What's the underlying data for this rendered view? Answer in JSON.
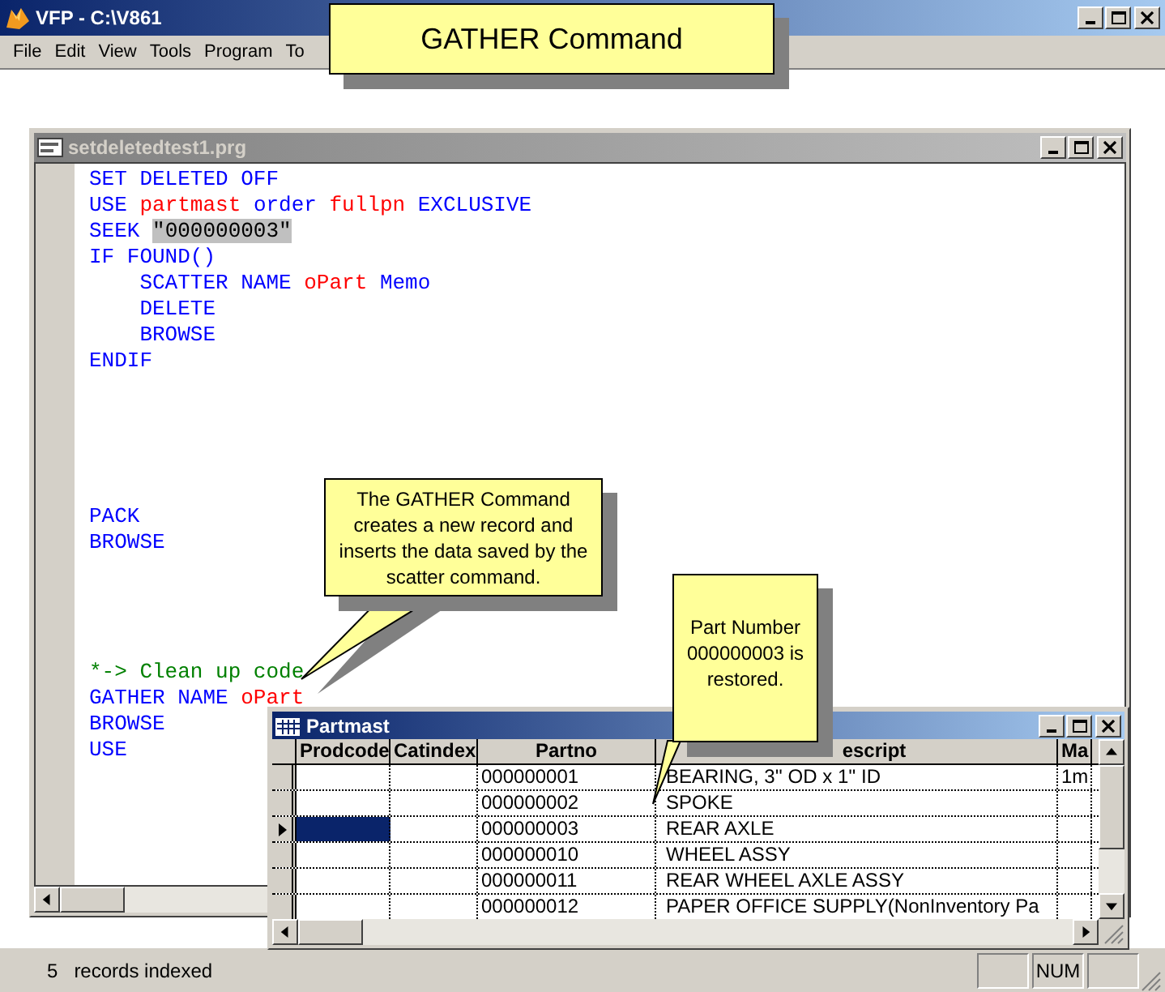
{
  "app_window": {
    "title": "VFP - C:\\V861"
  },
  "menu": [
    {
      "label": "File"
    },
    {
      "label": "Edit"
    },
    {
      "label": "View"
    },
    {
      "label": "Tools"
    },
    {
      "label": "Program"
    },
    {
      "label": "To"
    }
  ],
  "editor": {
    "title": "setdeletedtest1.prg",
    "lines": [
      {
        "kind": "code",
        "tokens": [
          {
            "text": "SET DELETED OFF",
            "kind": "keyword"
          }
        ]
      },
      {
        "kind": "code",
        "tokens": [
          {
            "text": "USE ",
            "kind": "keyword"
          },
          {
            "text": "partmast",
            "kind": "name"
          },
          {
            "text": " order ",
            "kind": "keyword"
          },
          {
            "text": "fullpn",
            "kind": "name"
          },
          {
            "text": " EXCLUSIVE",
            "kind": "keyword"
          }
        ]
      },
      {
        "kind": "code",
        "tokens": [
          {
            "text": "SEEK ",
            "kind": "keyword"
          },
          {
            "text": "\"000000003\"",
            "kind": "string",
            "highlighted": true
          }
        ]
      },
      {
        "kind": "code",
        "tokens": [
          {
            "text": "IF FOUND()",
            "kind": "keyword"
          }
        ]
      },
      {
        "kind": "code",
        "tokens": [
          {
            "text": "    SCATTER NAME ",
            "kind": "keyword"
          },
          {
            "text": "oPart",
            "kind": "name"
          },
          {
            "text": " Memo",
            "kind": "keyword"
          }
        ]
      },
      {
        "kind": "code",
        "tokens": [
          {
            "text": "    DELETE",
            "kind": "keyword"
          }
        ]
      },
      {
        "kind": "code",
        "tokens": [
          {
            "text": "    BROWSE",
            "kind": "keyword"
          }
        ]
      },
      {
        "kind": "code",
        "tokens": [
          {
            "text": "ENDIF",
            "kind": "keyword"
          }
        ]
      },
      {
        "kind": "blank"
      },
      {
        "kind": "blank"
      },
      {
        "kind": "blank"
      },
      {
        "kind": "blank"
      },
      {
        "kind": "blank"
      },
      {
        "kind": "code",
        "tokens": [
          {
            "text": "PACK",
            "kind": "keyword"
          }
        ]
      },
      {
        "kind": "code",
        "tokens": [
          {
            "text": "BROWSE",
            "kind": "keyword"
          }
        ]
      },
      {
        "kind": "blank"
      },
      {
        "kind": "blank"
      },
      {
        "kind": "blank"
      },
      {
        "kind": "blank"
      },
      {
        "kind": "code",
        "tokens": [
          {
            "text": "*-> Clean up code",
            "kind": "comment"
          }
        ]
      },
      {
        "kind": "code",
        "tokens": [
          {
            "text": "GATHER NAME ",
            "kind": "keyword"
          },
          {
            "text": "oPart",
            "kind": "name"
          }
        ]
      },
      {
        "kind": "code",
        "tokens": [
          {
            "text": "BROWSE",
            "kind": "keyword"
          }
        ]
      },
      {
        "kind": "code",
        "tokens": [
          {
            "text": "USE",
            "kind": "keyword"
          }
        ]
      }
    ]
  },
  "browse": {
    "title": "Partmast",
    "columns": [
      "Prodcode",
      "Catindex",
      "Partno",
      "escript",
      "Ma"
    ],
    "rows": [
      {
        "current": false,
        "partno": "000000001",
        "descript": "BEARING, 3'' OD x 1'' ID",
        "column_5": "1m"
      },
      {
        "current": false,
        "partno": "000000002",
        "descript": "SPOKE"
      },
      {
        "current": true,
        "partno": "000000003",
        "descript": "REAR AXLE"
      },
      {
        "current": false,
        "partno": "000000010",
        "descript": "WHEEL ASSY"
      },
      {
        "current": false,
        "partno": "000000011",
        "descript": "REAR WHEEL AXLE ASSY"
      },
      {
        "current": false,
        "partno": "000000012",
        "descript": "PAPER OFFICE SUPPLY(NonInventory Pa"
      }
    ]
  },
  "callouts": [
    {
      "kind": "title",
      "text": "GATHER Command"
    },
    {
      "kind": "pointer-left",
      "text": "The GATHER Command creates a new record and inserts the data saved by the scatter command."
    },
    {
      "kind": "pointer-down",
      "text": "Part Number 000000003 is restored."
    }
  ],
  "status_bar": {
    "count": "5",
    "message": "records indexed",
    "indicator": "NUM"
  }
}
